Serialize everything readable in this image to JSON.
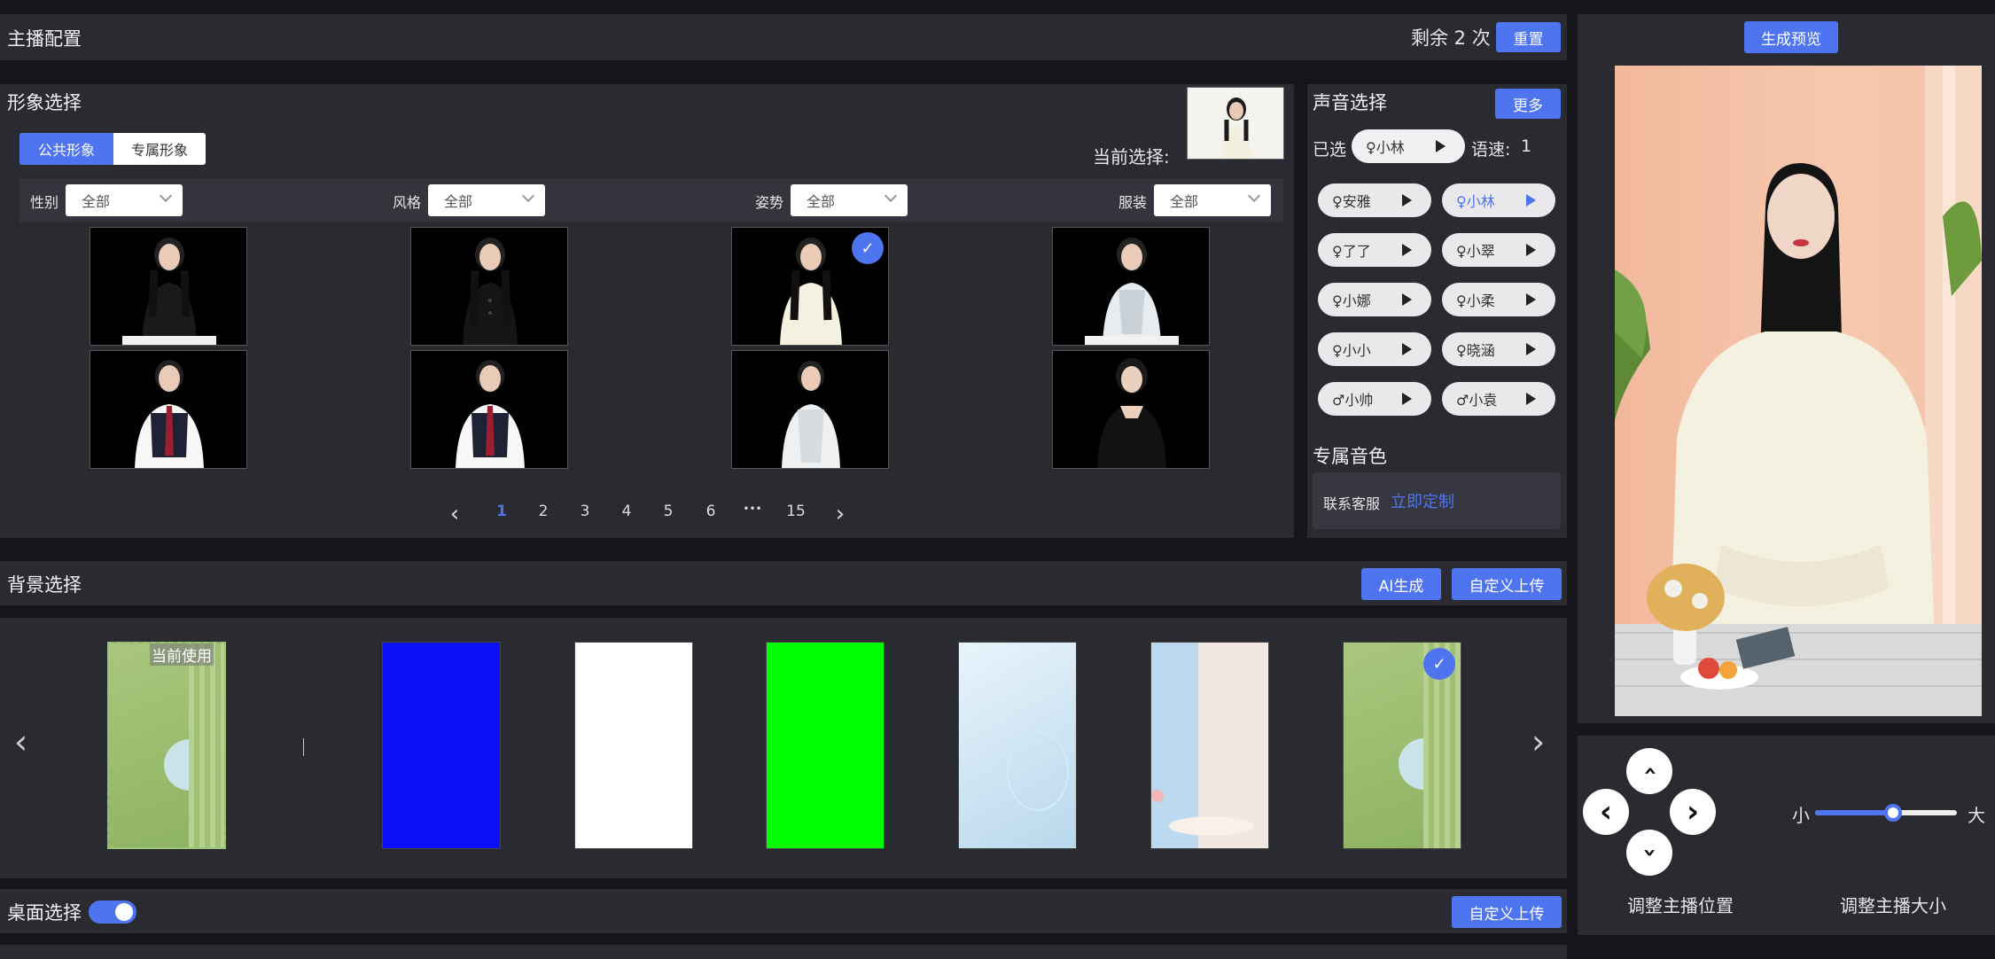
{
  "config": {
    "title": "主播配置",
    "remaining": "剩余 2 次",
    "reset": "重置"
  },
  "image_select": {
    "title": "形象选择",
    "tabs": [
      "公共形象",
      "专属形象"
    ],
    "current_label": "当前选择:",
    "filters": [
      {
        "label": "性别",
        "value": "全部"
      },
      {
        "label": "风格",
        "value": "全部"
      },
      {
        "label": "姿势",
        "value": "全部"
      },
      {
        "label": "服装",
        "value": "全部"
      }
    ],
    "pagination": {
      "prev": "‹",
      "pages": [
        "1",
        "2",
        "3",
        "4",
        "5",
        "6",
        "•••",
        "15"
      ],
      "next": "›",
      "current": "1"
    }
  },
  "voice": {
    "title": "声音选择",
    "more": "更多",
    "selected_label": "已选",
    "selected_voice": "♀小林",
    "speed_label": "语速:",
    "speed_value": "1",
    "voices": [
      {
        "name": "♀安雅"
      },
      {
        "name": "♀小林"
      },
      {
        "name": "♀了了"
      },
      {
        "name": "♀小翠"
      },
      {
        "name": "♀小娜"
      },
      {
        "name": "♀小柔"
      },
      {
        "name": "♀小小"
      },
      {
        "name": "♀晓涵"
      },
      {
        "name": "♂小帅"
      },
      {
        "name": "♂小袁"
      }
    ],
    "exclusive_title": "专属音色",
    "contact_label": "联系客服",
    "custom_link": "立即定制"
  },
  "background": {
    "title": "背景选择",
    "ai_btn": "AI生成",
    "upload_btn": "自定义上传",
    "current_badge": "当前使用"
  },
  "desk": {
    "title": "桌面选择",
    "upload_btn": "自定义上传"
  },
  "preview": {
    "generate_btn": "生成预览",
    "position_label": "调整主播位置",
    "size_label": "调整主播大小",
    "size_min": "小",
    "size_max": "大",
    "size_value": 0.55
  },
  "colors": {
    "accent": "#4f74ef",
    "panel": "#2a2b31",
    "bg": "#16161a"
  }
}
